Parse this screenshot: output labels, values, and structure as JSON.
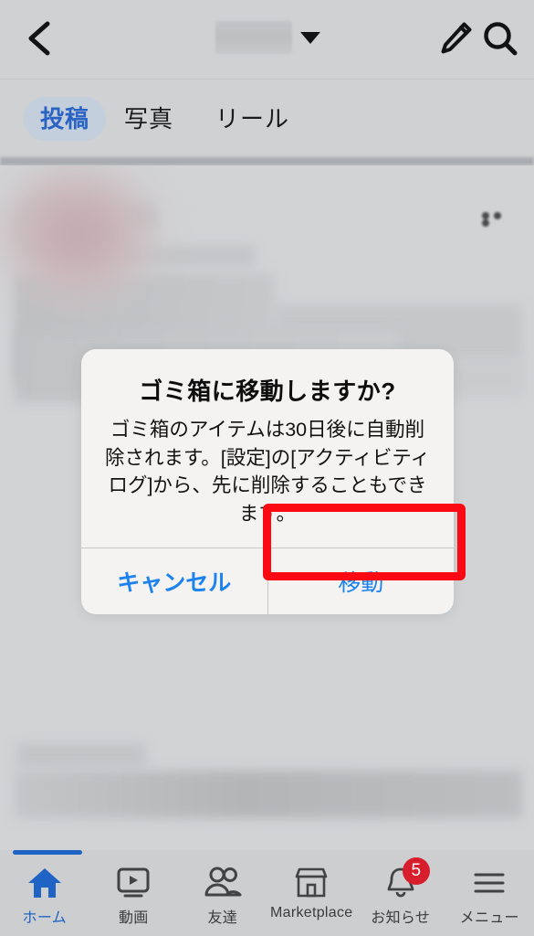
{
  "topbar": {
    "back_icon": "back-chevron-icon",
    "title_redacted": "",
    "caret_icon": "chevron-down-icon",
    "edit_icon": "pencil-icon",
    "search_icon": "search-icon"
  },
  "tabs": [
    {
      "label": "投稿",
      "active": true
    },
    {
      "label": "写真",
      "active": false
    },
    {
      "label": "リール",
      "active": false
    }
  ],
  "feed": {
    "post_menu_icon": "ellipsis-icon",
    "note": "blurred post content"
  },
  "dialog": {
    "title": "ゴミ箱に移動しますか?",
    "message": "ゴミ箱のアイテムは30日後に自動削除されます。[設定]の[アクティビティログ]から、先に削除することもできます。",
    "cancel_label": "キャンセル",
    "confirm_label": "移動",
    "accent_color": "#1b82f0",
    "highlight_color": "#fb0a13"
  },
  "bottomnav": [
    {
      "label": "ホーム",
      "icon": "home-icon",
      "active": true,
      "badge": ""
    },
    {
      "label": "動画",
      "icon": "video-icon",
      "active": false,
      "badge": ""
    },
    {
      "label": "友達",
      "icon": "friends-icon",
      "active": false,
      "badge": ""
    },
    {
      "label": "Marketplace",
      "icon": "marketplace-icon",
      "active": false,
      "badge": ""
    },
    {
      "label": "お知らせ",
      "icon": "bell-icon",
      "active": false,
      "badge": "5"
    },
    {
      "label": "メニュー",
      "icon": "hamburger-menu-icon",
      "active": false,
      "badge": ""
    }
  ]
}
